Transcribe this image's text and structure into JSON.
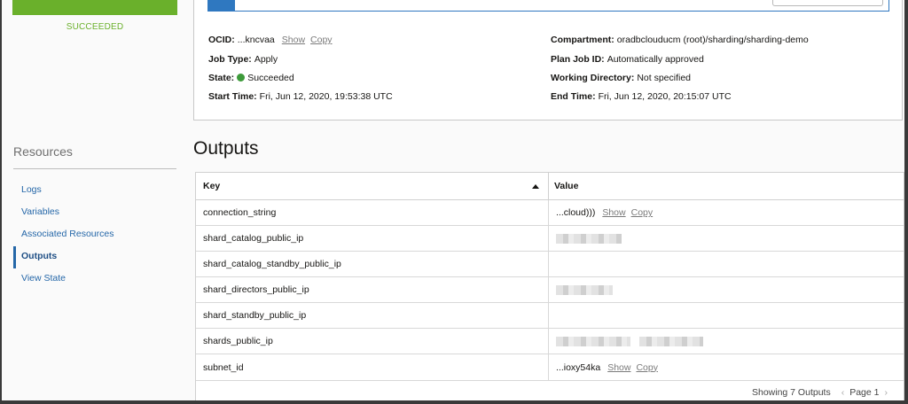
{
  "job_status": {
    "label": "SUCCEEDED",
    "color": "#6ab02b"
  },
  "details": {
    "ocid": {
      "label": "OCID:",
      "value": "...kncvaa",
      "show": "Show",
      "copy": "Copy"
    },
    "job_type": {
      "label": "Job Type:",
      "value": "Apply"
    },
    "state": {
      "label": "State:",
      "value": "Succeeded",
      "dot_color": "#3d9a3a"
    },
    "start_time": {
      "label": "Start Time:",
      "value": "Fri, Jun 12, 2020, 19:53:38 UTC"
    },
    "compartment": {
      "label": "Compartment:",
      "value": "oradbclouducm (root)/sharding/sharding-demo"
    },
    "plan_job_id": {
      "label": "Plan Job ID:",
      "value": "Automatically approved"
    },
    "working_directory": {
      "label": "Working Directory:",
      "value": "Not specified"
    },
    "end_time": {
      "label": "End Time:",
      "value": "Fri, Jun 12, 2020, 20:15:07 UTC"
    }
  },
  "resources": {
    "title": "Resources",
    "items": [
      {
        "label": "Logs",
        "active": false
      },
      {
        "label": "Variables",
        "active": false
      },
      {
        "label": "Associated Resources",
        "active": false
      },
      {
        "label": "Outputs",
        "active": true
      },
      {
        "label": "View State",
        "active": false
      }
    ]
  },
  "outputs": {
    "title": "Outputs",
    "columns": {
      "key": "Key",
      "value": "Value"
    },
    "sort_icon": "sort-ascending-icon",
    "rows": [
      {
        "key": "connection_string",
        "value": "...cloud)))",
        "show": "Show",
        "copy": "Copy"
      },
      {
        "key": "shard_catalog_public_ip",
        "value": "",
        "redacted": true,
        "redacted_chips": [
          1
        ]
      },
      {
        "key": "shard_catalog_standby_public_ip",
        "value": ""
      },
      {
        "key": "shard_directors_public_ip",
        "value": "",
        "redacted": true,
        "redacted_chips": [
          1
        ]
      },
      {
        "key": "shard_standby_public_ip",
        "value": ""
      },
      {
        "key": "shards_public_ip",
        "value": "",
        "redacted": true,
        "redacted_chips": [
          1,
          1
        ]
      },
      {
        "key": "subnet_id",
        "value": "...ioxy54ka",
        "show": "Show",
        "copy": "Copy"
      }
    ],
    "footer": {
      "showing": "Showing 7 Outputs",
      "page": "Page 1"
    }
  },
  "colors": {
    "link": "#2567a8",
    "accent_blue": "#2f78c0",
    "success": "#6ab02b"
  }
}
